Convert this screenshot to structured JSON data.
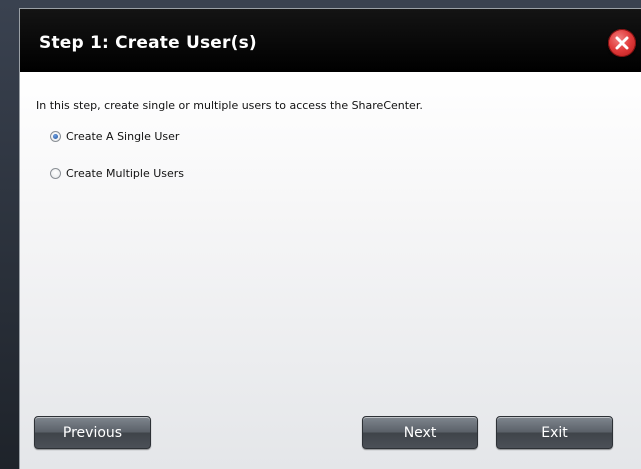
{
  "dialog": {
    "title": "Step 1: Create User(s)",
    "intro": "In this step, create single or multiple users to access the ShareCenter.",
    "options": [
      {
        "label": "Create A Single User",
        "selected": true
      },
      {
        "label": "Create Multiple Users",
        "selected": false
      }
    ],
    "buttons": {
      "previous": "Previous",
      "next": "Next",
      "exit": "Exit"
    }
  },
  "colors": {
    "titlebar": "#000000",
    "close_button": "#e23c3c",
    "button": "#5b6169"
  },
  "icons": {
    "close": "close-x-icon"
  }
}
